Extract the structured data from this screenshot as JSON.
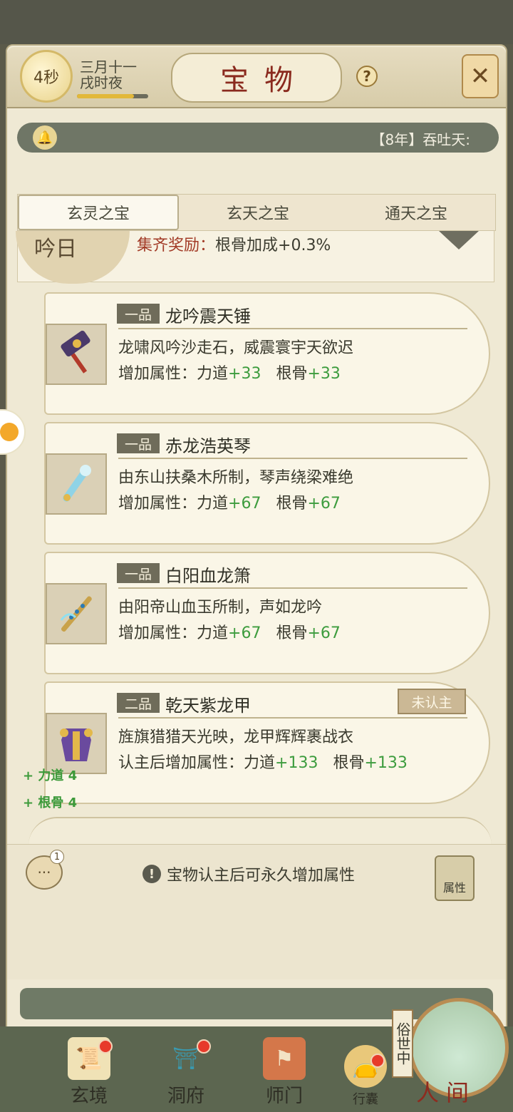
{
  "header": {
    "timer": "4秒",
    "date_line1": "三月十一",
    "date_line2": "戌时夜",
    "time_progress": 0.8,
    "title": "宝物",
    "help_label": "?"
  },
  "ticker": {
    "text": "【8年】吞吐天:"
  },
  "tabs": [
    {
      "label": "玄灵之宝",
      "active": true
    },
    {
      "label": "玄天之宝",
      "active": false
    },
    {
      "label": "通天之宝",
      "active": false
    }
  ],
  "collection": {
    "seal_text": "吟日",
    "label": "集齐奖励：",
    "value": "根骨加成+0.3%"
  },
  "items": [
    {
      "grade": "一品",
      "name": "龙吟震天锤",
      "desc": "龙啸风吟沙走石，威震寰宇天欲迟",
      "stat_prefix": "增加属性：",
      "stat1_name": "力道",
      "stat1_val": "+33",
      "stat2_name": "根骨",
      "stat2_val": "+33",
      "status": "",
      "icon": "hammer-icon"
    },
    {
      "grade": "一品",
      "name": "赤龙浩英琴",
      "desc": "由东山扶桑木所制，琴声绕梁难绝",
      "stat_prefix": "增加属性：",
      "stat1_name": "力道",
      "stat1_val": "+67",
      "stat2_name": "根骨",
      "stat2_val": "+67",
      "status": "",
      "icon": "zither-icon"
    },
    {
      "grade": "一品",
      "name": "白阳血龙箫",
      "desc": "由阳帝山血玉所制，声如龙吟",
      "stat_prefix": "增加属性：",
      "stat1_name": "力道",
      "stat1_val": "+67",
      "stat2_name": "根骨",
      "stat2_val": "+67",
      "status": "",
      "icon": "flute-icon"
    },
    {
      "grade": "二品",
      "name": "乾天紫龙甲",
      "desc": "旌旗猎猎天光映，龙甲辉辉裹战衣",
      "stat_prefix": "认主后增加属性：",
      "stat1_name": "力道",
      "stat1_val": "+133",
      "stat2_name": "根骨",
      "stat2_val": "+133",
      "status": "未认主",
      "icon": "armor-icon"
    }
  ],
  "float_stats": [
    "+ 力道 4",
    "+ 根骨 4"
  ],
  "footer": {
    "chat_count": "1",
    "notice": "宝物认主后可永久增加属性",
    "attr_label": "属性"
  },
  "nav": [
    {
      "label": "玄境",
      "icon": "scroll-icon",
      "dot": true,
      "active": true
    },
    {
      "label": "洞府",
      "icon": "pavilion-icon",
      "dot": true,
      "active": false
    },
    {
      "label": "师门",
      "icon": "banner-icon",
      "dot": false,
      "active": false
    },
    {
      "label": "行囊",
      "icon": "bag-icon",
      "dot": true,
      "active": false
    }
  ],
  "world": {
    "tag": "俗世中",
    "label": "人间"
  },
  "colors": {
    "panel": "#efe9d4",
    "title_red": "#8a2a1e",
    "stat_green": "#3d9c3e",
    "nav_green": "#5c6650"
  }
}
